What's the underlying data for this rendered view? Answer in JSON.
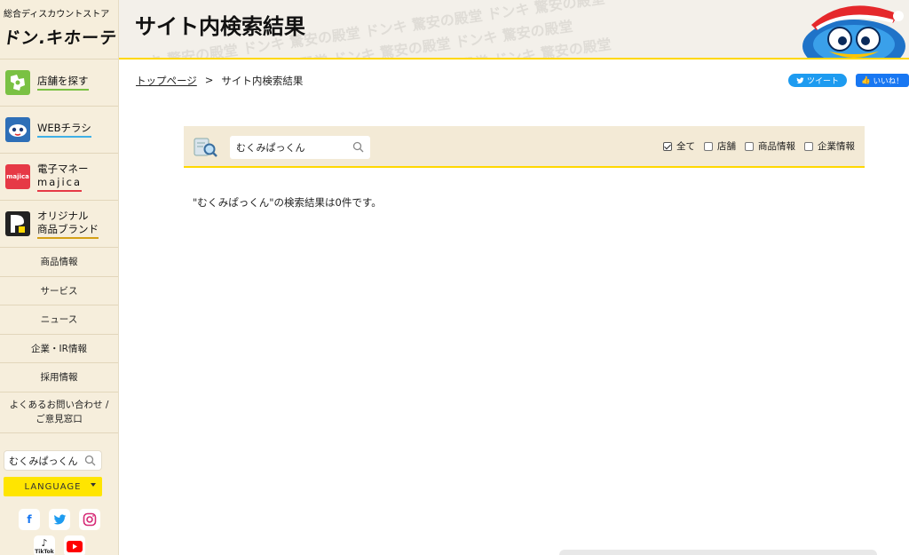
{
  "brand": {
    "tagline": "総合ディスカウントストア",
    "logo_text": "ドン.キホーテ"
  },
  "sidebar": {
    "features": [
      {
        "line1": "店舗を探す",
        "line2": "",
        "icon": "map-icon",
        "color": "#7ac143"
      },
      {
        "line1": "WEBチラシ",
        "line2": "",
        "icon": "flyer-icon",
        "color": "#3fb0e6"
      },
      {
        "line1": "電子マネー",
        "line2": "majica",
        "icon": "majica-card-icon",
        "color": "#e63946"
      },
      {
        "line1": "オリジナル",
        "line2": "商品ブランド",
        "icon": "original-brand-icon",
        "color": "#d4a017"
      }
    ],
    "links": [
      "商品情報",
      "サービス",
      "ニュース",
      "企業・IR情報",
      "採用情報"
    ],
    "contact": {
      "line1": "よくあるお問い合わせ /",
      "line2": "ご意見窓口"
    },
    "search_value": "むくみぱっくん",
    "language_label": "LANGUAGE",
    "social_row1": [
      "facebook-icon",
      "twitter-icon",
      "instagram-icon"
    ],
    "social_row2": [
      "tiktok-icon",
      "youtube-icon"
    ],
    "tiktok_label": "TikTok"
  },
  "header": {
    "title": "サイト内検索結果",
    "pattern_text": "ドンキ 驚安の殿堂 ドンキ 驚安の殿堂 ドンキ 驚安の殿堂 ドンキ 驚安の殿堂"
  },
  "breadcrumb": {
    "home": "トップページ",
    "separator": ">",
    "current": "サイト内検索結果"
  },
  "share": {
    "tweet": "ツイート",
    "like": "いいね！"
  },
  "search_panel": {
    "query": "むくみぱっくん",
    "filters": [
      {
        "label": "全て",
        "checked": true
      },
      {
        "label": "店舗",
        "checked": false
      },
      {
        "label": "商品情報",
        "checked": false
      },
      {
        "label": "企業情報",
        "checked": false
      }
    ]
  },
  "result_message": "\"むくみぱっくん\"の検索結果は0件です。"
}
